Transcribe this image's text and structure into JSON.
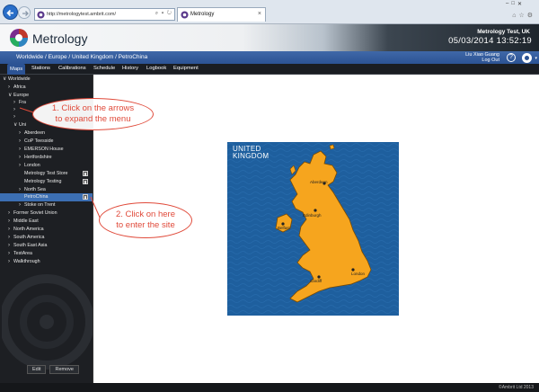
{
  "browser": {
    "url": "http://metrologytest.ambrit.com/",
    "tab_title": "Metrology",
    "address_tools": "⌕ ▾ ↻"
  },
  "header": {
    "app_name": "Metrology",
    "company": "Metrology Test, UK",
    "datetime": "05/03/2014  13:52:19"
  },
  "breadcrumb": "Worldwide / Europe / United Kingdom / PetroChina",
  "user": {
    "name": "Liu Xiao Guang",
    "logout": "Log Out"
  },
  "menu": [
    "Maps",
    "Stations",
    "Calibrations",
    "Schedule",
    "History",
    "Logbook",
    "Equipment"
  ],
  "tree": [
    {
      "label": "Worldwide",
      "arrow": "∨"
    },
    {
      "label": "Africa",
      "arrow": "›"
    },
    {
      "label": "Europe",
      "arrow": "∨"
    },
    {
      "label": "Fra",
      "arrow": "›"
    },
    {
      "label": "",
      "arrow": "›"
    },
    {
      "label": "",
      "arrow": "›"
    },
    {
      "label": "Uni",
      "arrow": "∨"
    },
    {
      "label": "Aberdeen",
      "arrow": "›"
    },
    {
      "label": "CoP Teesside",
      "arrow": "›"
    },
    {
      "label": "EMERSON House",
      "arrow": "›"
    },
    {
      "label": "Hertfordshire",
      "arrow": "›"
    },
    {
      "label": "London",
      "arrow": "›"
    },
    {
      "label": "Metrology Test Store",
      "arrow": ""
    },
    {
      "label": "Metrology Testing",
      "arrow": ""
    },
    {
      "label": "North Sea",
      "arrow": "›"
    },
    {
      "label": "PetroChina",
      "arrow": ""
    },
    {
      "label": "Stoke on Trent",
      "arrow": "›"
    },
    {
      "label": "Former Soviet Union",
      "arrow": "›"
    },
    {
      "label": "Middle East",
      "arrow": "›"
    },
    {
      "label": "North America",
      "arrow": "›"
    },
    {
      "label": "South America",
      "arrow": "›"
    },
    {
      "label": "South East Asia",
      "arrow": "›"
    },
    {
      "label": "TestArea",
      "arrow": "›"
    },
    {
      "label": "Walkthrough",
      "arrow": "›"
    }
  ],
  "sidebar_buttons": {
    "edit": "Edit",
    "remove": "Remove"
  },
  "annotations": {
    "callout1_line1": "1. Click on the arrows",
    "callout1_line2": "to expand the menu",
    "callout2_line1": "2. Click on here",
    "callout2_line2": "to enter the site"
  },
  "map": {
    "title_line1": "UNITED",
    "title_line2": "KINGDOM",
    "cities": [
      "Aberdeen",
      "Edinburgh",
      "Belfast",
      "Cardiff",
      "London"
    ]
  },
  "footer": {
    "copyright": "©Ambrit Ltd 2013"
  },
  "colors": {
    "accent": "#2c5394",
    "selected": "#3c6fb3",
    "annotation": "#e04a3a",
    "map_sea": "#1e5f9e",
    "map_land": "#f6a51e"
  }
}
